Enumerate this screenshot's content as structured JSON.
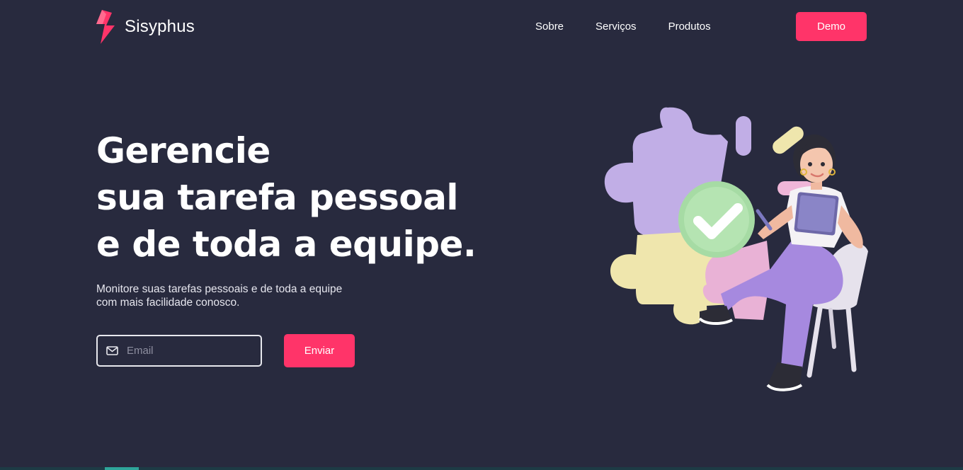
{
  "brand": {
    "name": "Sisyphus",
    "accent_color": "#ff3469",
    "background_color": "#282a3e"
  },
  "nav": {
    "items": [
      {
        "label": "Sobre"
      },
      {
        "label": "Serviços"
      },
      {
        "label": "Produtos"
      }
    ]
  },
  "header": {
    "demo_label": "Demo"
  },
  "hero": {
    "headline_lines": [
      "Gerencie",
      "sua tarefa pessoal",
      "e de toda a equipe."
    ],
    "subtitle_lines": [
      "Monitore suas tarefas pessoais e de toda a equipe",
      "com mais facilidade conosco."
    ],
    "email": {
      "placeholder": "Email",
      "value": "",
      "icon": "mail-icon"
    },
    "submit_label": "Enviar"
  },
  "illustration": {
    "subject": "woman-with-tablet-puzzle-checkmark"
  }
}
